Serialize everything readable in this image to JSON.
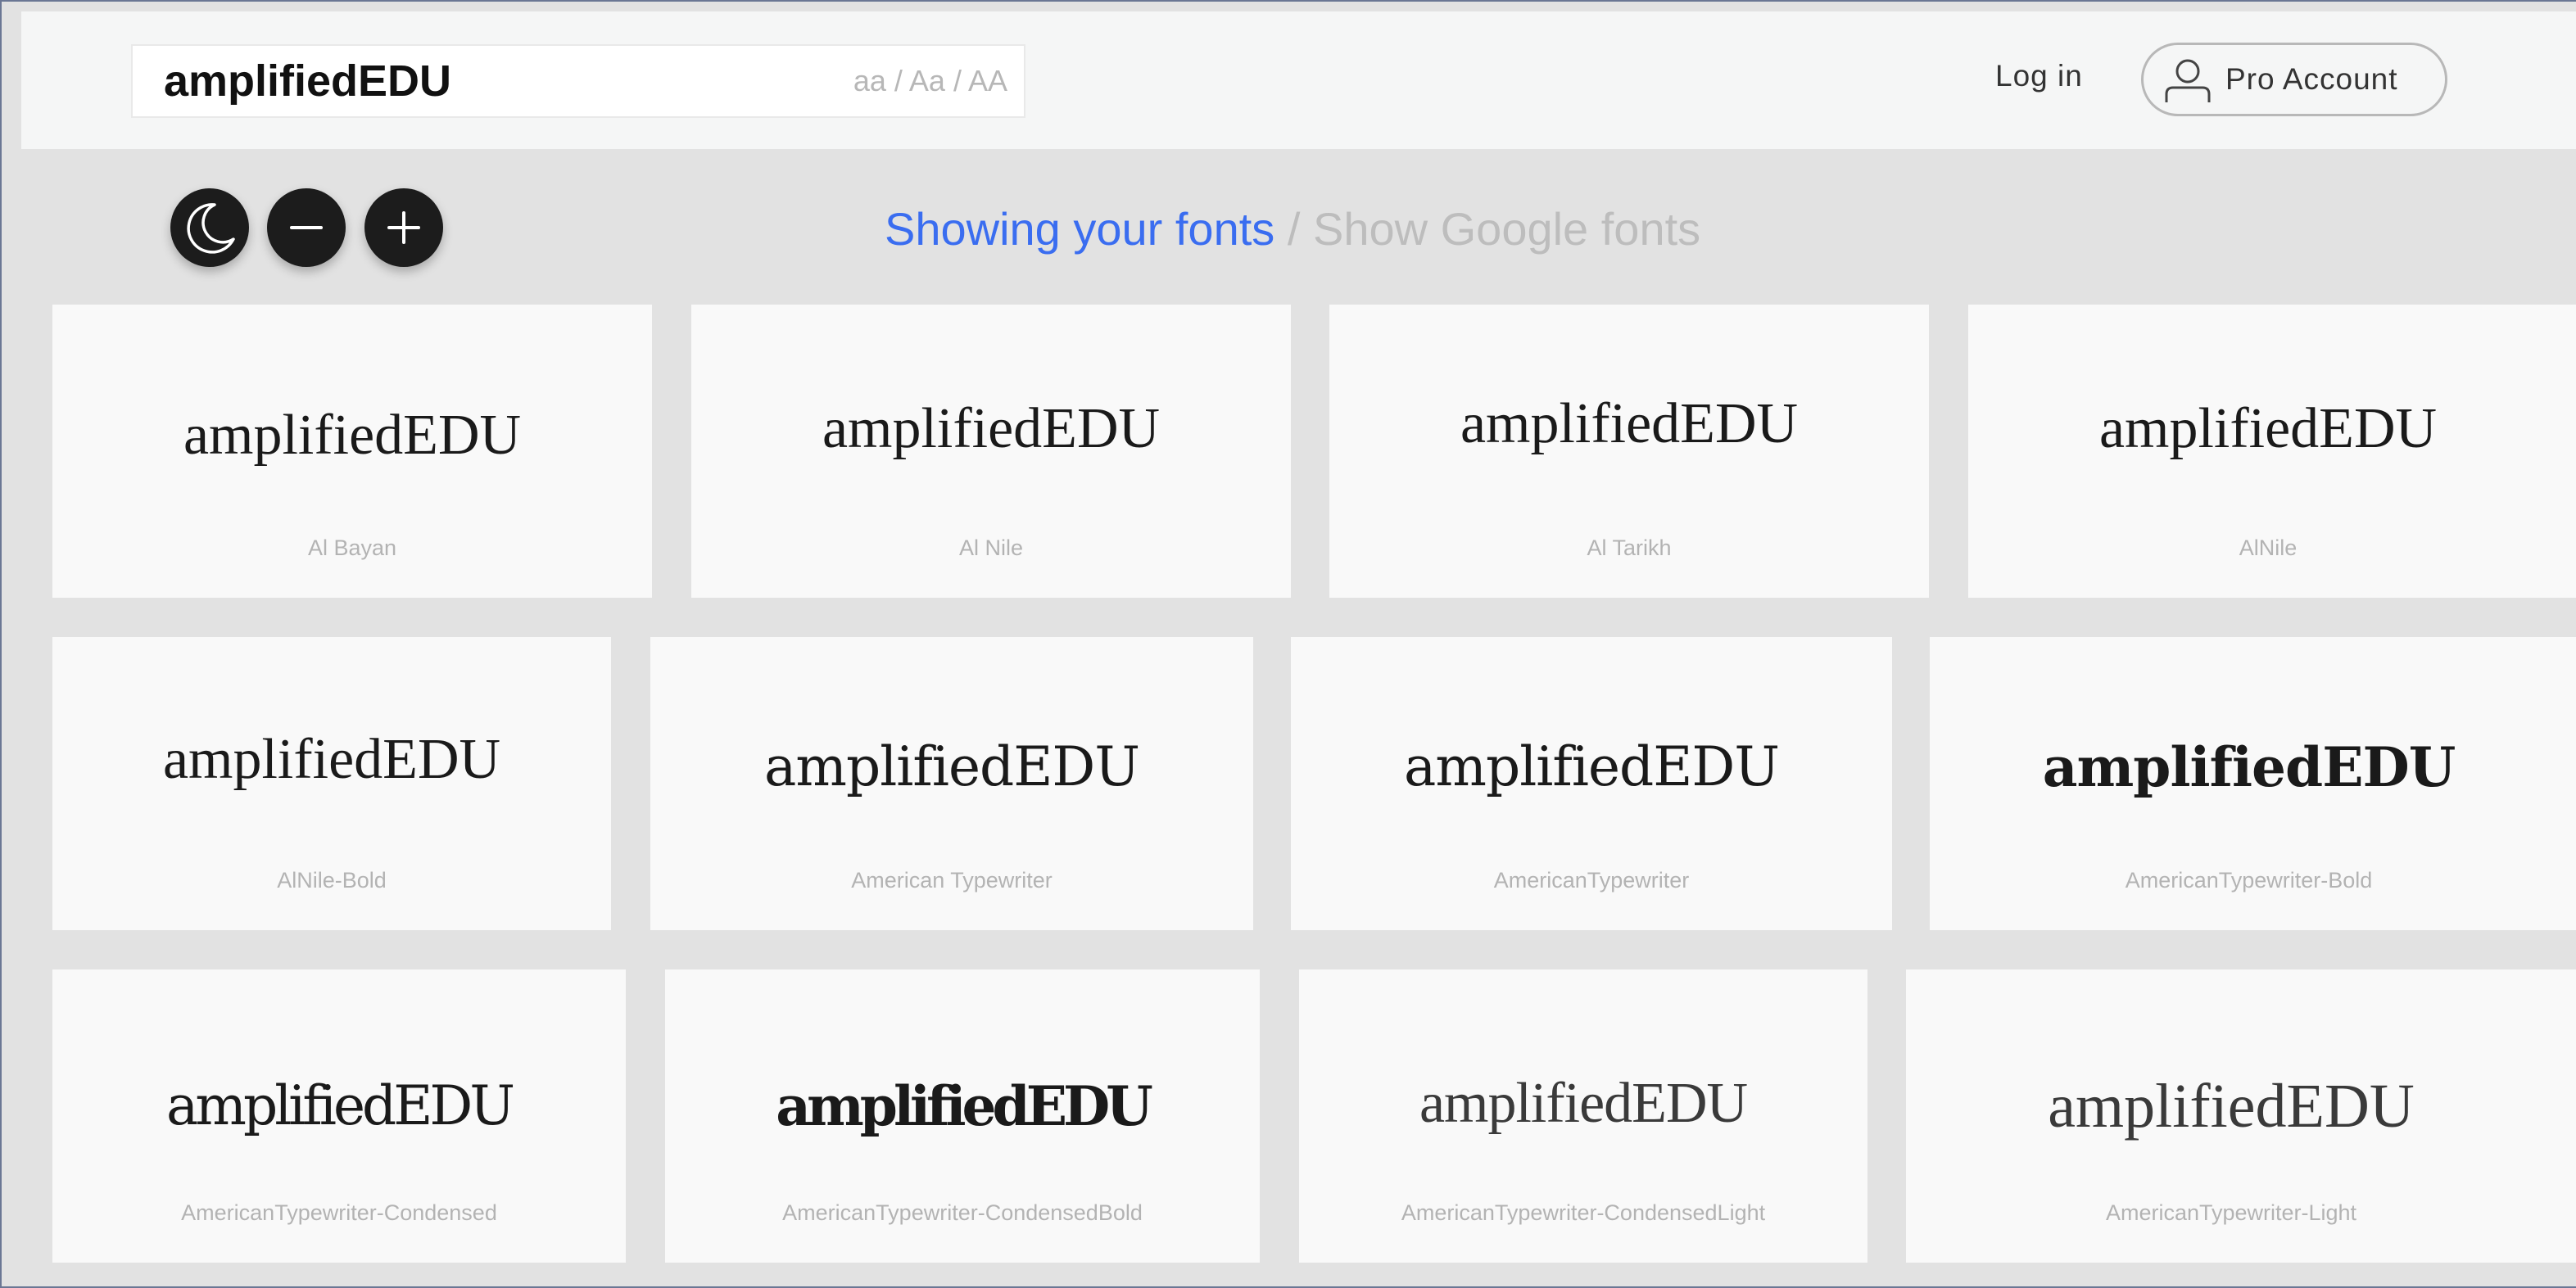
{
  "header": {
    "search_value": "amplifiedEDU",
    "case_options": [
      "aa",
      "Aa",
      "AA"
    ],
    "case_separator": " / ",
    "login_label": "Log in",
    "pro_label": "Pro Account"
  },
  "toolbar": {
    "buttons": [
      "moon-icon",
      "minus-icon",
      "plus-icon"
    ],
    "source_active": "Showing your fonts",
    "source_separator": " / ",
    "source_inactive": "Show Google fonts"
  },
  "cards": [
    {
      "sample": "amplifiedEDU",
      "font": "Al Bayan"
    },
    {
      "sample": "amplifiedEDU",
      "font": "Al Nile"
    },
    {
      "sample": "amplifiedEDU",
      "font": "Al Tarikh"
    },
    {
      "sample": "amplifiedEDU",
      "font": "AlNile"
    },
    {
      "sample": "amplifiedEDU",
      "font": "AlNile-Bold"
    },
    {
      "sample": "amplifiedEDU",
      "font": "American Typewriter"
    },
    {
      "sample": "amplifiedEDU",
      "font": "AmericanTypewriter"
    },
    {
      "sample": "amplifiedEDU",
      "font": "AmericanTypewriter-Bold"
    },
    {
      "sample": "amplifiedEDU",
      "font": "AmericanTypewriter-Condensed"
    },
    {
      "sample": "amplifiedEDU",
      "font": "AmericanTypewriter-CondensedBold"
    },
    {
      "sample": "amplifiedEDU",
      "font": "AmericanTypewriter-CondensedLight"
    },
    {
      "sample": "amplifiedEDU",
      "font": "AmericanTypewriter-Light"
    }
  ],
  "colors": {
    "accent": "#3a6df0",
    "inactive_text": "#bdbdbd",
    "page_background": "#e2e2e2",
    "card_background": "#f9f9f9",
    "header_background": "#f5f6f6",
    "button_dark": "#1c1c1c"
  }
}
